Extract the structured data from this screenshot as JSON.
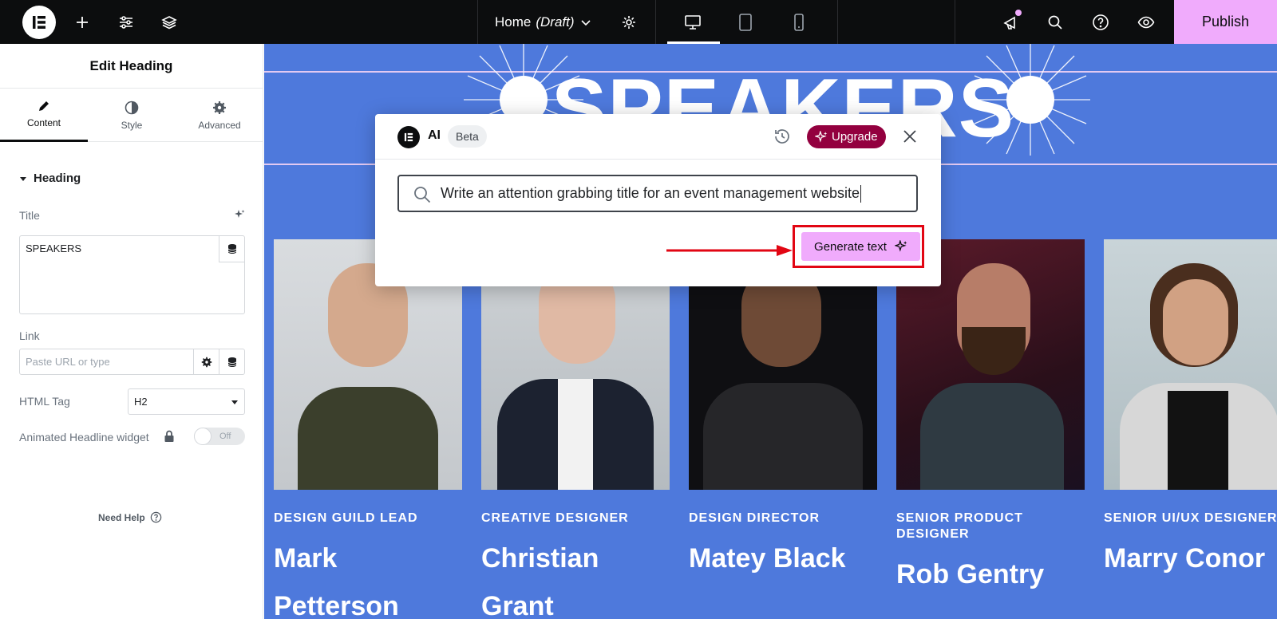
{
  "topbar": {
    "page_name": "Home",
    "page_status": "(Draft)",
    "publish_label": "Publish"
  },
  "panel": {
    "title": "Edit Heading",
    "tabs": [
      {
        "label": "Content",
        "icon": "pencil-icon"
      },
      {
        "label": "Style",
        "icon": "contrast-icon"
      },
      {
        "label": "Advanced",
        "icon": "gear-icon"
      }
    ],
    "section_title": "Heading",
    "title_label": "Title",
    "title_value": "SPEAKERS",
    "link_label": "Link",
    "link_placeholder": "Paste URL or type",
    "html_tag_label": "HTML Tag",
    "html_tag_value": "H2",
    "animated_label": "Animated Headline widget",
    "toggle_state": "Off",
    "need_help": "Need Help"
  },
  "canvas": {
    "heading": "SPEAKERS",
    "speakers": [
      {
        "role": "DESIGN GUILD LEAD",
        "name": "Mark Petterson"
      },
      {
        "role": "CREATIVE DESIGNER",
        "name": "Christian Grant"
      },
      {
        "role": "DESIGN DIRECTOR",
        "name": "Matey Black"
      },
      {
        "role": "SENIOR PRODUCT DESIGNER",
        "name": "Rob Gentry"
      },
      {
        "role": "SENIOR UI/UX DESIGNER",
        "name": "Marry Conor"
      }
    ]
  },
  "ai_dialog": {
    "ai_label": "AI",
    "beta_label": "Beta",
    "upgrade_label": "Upgrade",
    "prompt_text": "Write an attention grabbing title for an event management website",
    "generate_label": "Generate text"
  },
  "colors": {
    "accent_pink": "#f0abfc",
    "canvas_blue": "#4e79dc",
    "upgrade_red": "#93003f",
    "highlight_red": "#e20613"
  }
}
